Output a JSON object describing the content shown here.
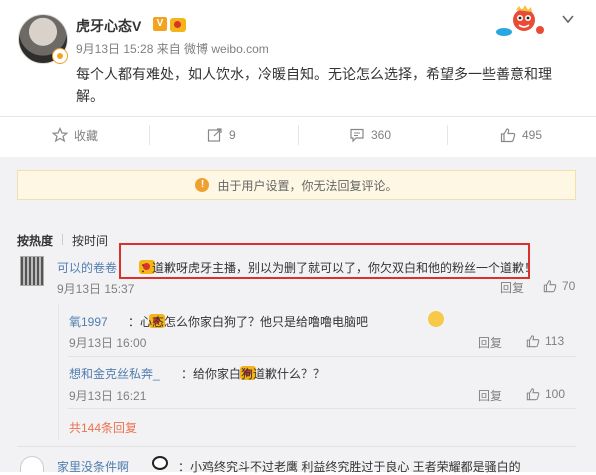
{
  "post": {
    "username": "虎牙心态V",
    "verified_badge": "V",
    "meta": "9月13日 15:28 来自 微博 weibo.com",
    "content": "每个人都有难处，如人饮水，冷暖自知。无论怎么选择，希望多一些善意和理解。",
    "actions": {
      "favorite": "收藏",
      "repost": "9",
      "comment": "360",
      "like": "495"
    }
  },
  "notice": "由于用户设置，你无法回复评论。",
  "sort": {
    "hot": "按热度",
    "time": "按时间"
  },
  "comments": [
    {
      "name": "可以的卷卷",
      "text": "：道歉呀虎牙主播，别以为删了就可以了，你欠双白和他的粉丝一个道歉！",
      "time": "9月13日 15:37",
      "reply": "回复",
      "likes": "70",
      "replies": [
        {
          "name": "氧1997",
          "text": "：心态怎么你家白狗了？他只是给噜噜电脑吧",
          "time": "9月13日 16:00",
          "reply": "回复",
          "likes": "113"
        },
        {
          "name": "想和金克丝私奔_",
          "text": "：给你家白狗道歉什么？？",
          "time": "9月13日 16:21",
          "reply": "回复",
          "likes": "100"
        }
      ],
      "more": "共144条回复"
    },
    {
      "name": "家里没条件啊",
      "text": "：小鸡终究斗不过老鹰 利益终究胜过于良心 王者荣耀都是骚白的"
    }
  ],
  "colors": {
    "accent": "#eb7350",
    "link": "#507daf",
    "highlight": "#d9312b",
    "notice_bg": "#fdf7e3"
  }
}
